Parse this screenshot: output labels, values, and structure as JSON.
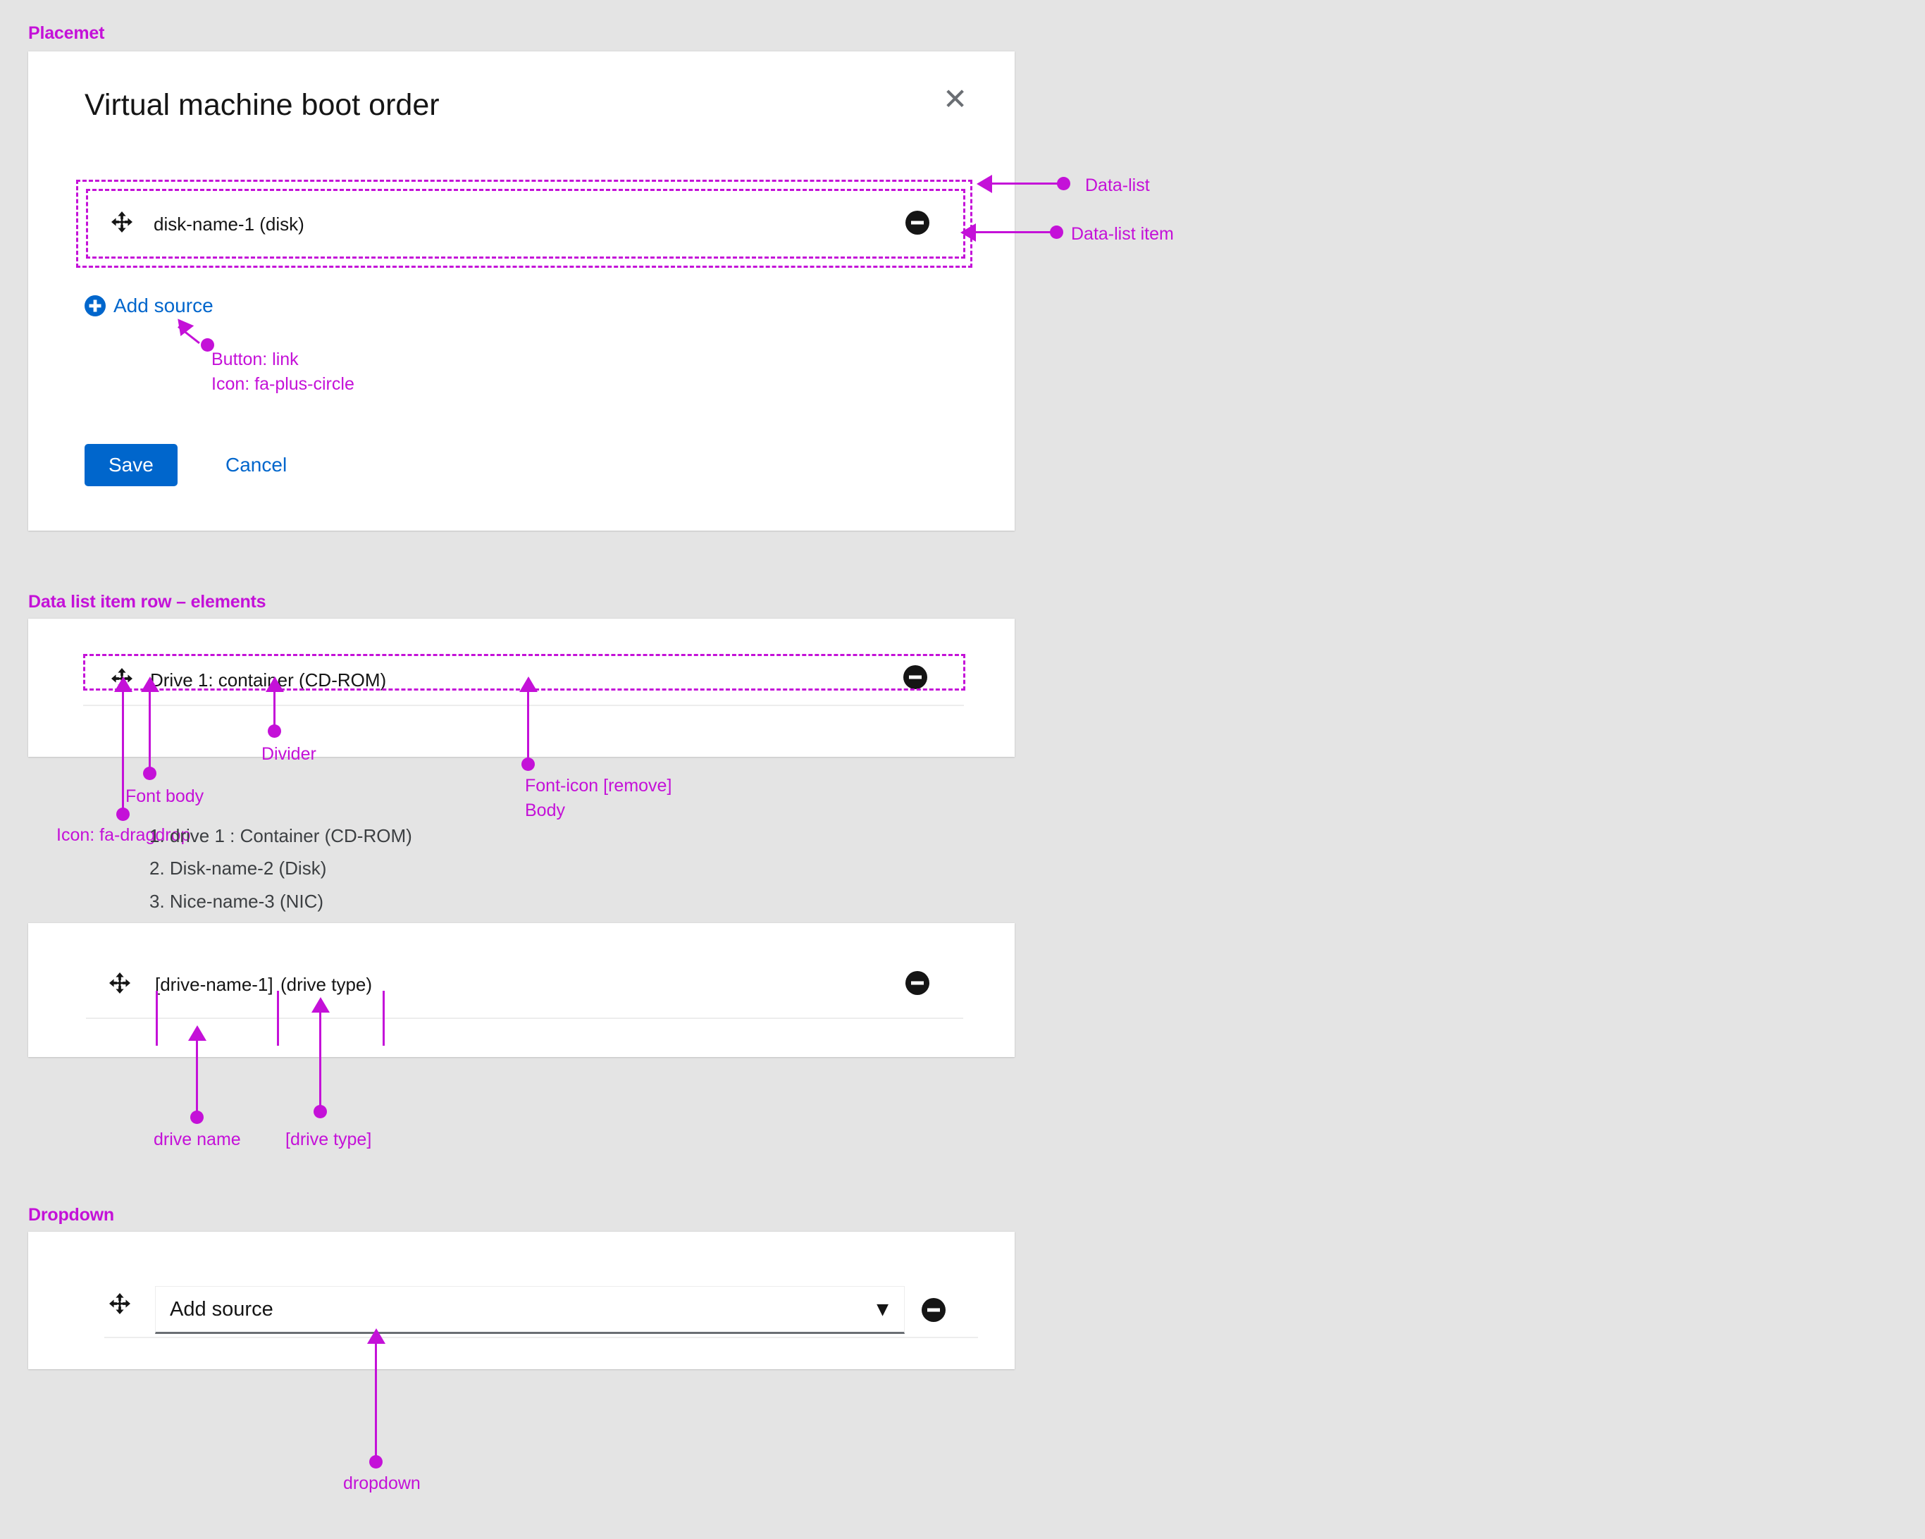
{
  "sections": {
    "placement": {
      "heading": "Placemet"
    },
    "row_elements": {
      "heading": "Data list item row – elements"
    },
    "dropdown": {
      "heading": "Dropdown"
    }
  },
  "modal": {
    "title": "Virtual machine boot order",
    "close_icon": "✕",
    "list_item": {
      "drag_icon": "fa-dragdrop",
      "label": "disk-name-1 (disk)",
      "remove_icon": "minus-circle"
    },
    "add_source": {
      "label": "Add source",
      "icon": "fa-plus-circle"
    },
    "save_label": "Save",
    "cancel_label": "Cancel"
  },
  "annotations": {
    "data_list": "Data-list",
    "data_list_item": "Data-list item",
    "button_link": "Button: link",
    "icon_plus_circle": "Icon: fa-plus-circle",
    "icon_dragdrop": "Icon: fa-dragdrop",
    "font_body": "Font body",
    "divider": "Divider",
    "font_icon_remove": "Font-icon [remove]",
    "font_icon_remove_body": "Body",
    "drive_name": "drive name",
    "drive_type": "[drive type]",
    "dropdown": "dropdown"
  },
  "row_example": {
    "drag_icon": "fa-dragdrop",
    "label": "Drive 1: container (CD-ROM)",
    "remove_icon": "minus-circle"
  },
  "numbered_list": [
    "1. drive 1 : Container (CD-ROM)",
    "2. Disk-name-2 (Disk)",
    "3. Nice-name-3 (NIC)"
  ],
  "template_row": {
    "drag_icon": "fa-dragdrop",
    "name_token": "[drive-name-1]",
    "type_token": "(drive type)",
    "remove_icon": "minus-circle"
  },
  "dropdown_row": {
    "drag_icon": "fa-dragdrop",
    "selected": "Add source",
    "caret_icon": "▼",
    "remove_icon": "minus-circle"
  },
  "colors": {
    "annotation": "#c411d8",
    "primary": "#0066cc",
    "page_bg": "#e4e4e4",
    "text": "#151515"
  }
}
